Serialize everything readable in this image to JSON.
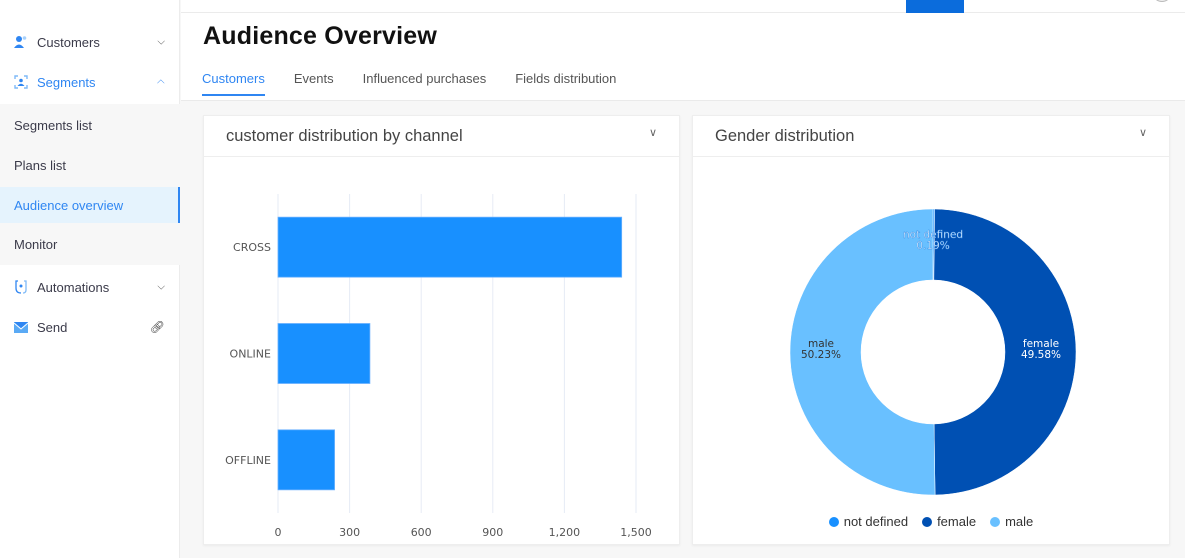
{
  "sidebar": {
    "items": [
      {
        "label": "Customers",
        "icon": "user-group-icon",
        "chevron": "chevron-down"
      },
      {
        "label": "Segments",
        "icon": "segment-icon",
        "chevron": "chevron-up"
      },
      {
        "label": "Automations",
        "icon": "automation-icon",
        "chevron": "chevron-down"
      },
      {
        "label": "Send",
        "icon": "envelope-icon",
        "chevron": "link"
      }
    ],
    "submenu": [
      {
        "label": "Segments list"
      },
      {
        "label": "Plans list"
      },
      {
        "label": "Audience overview"
      },
      {
        "label": "Monitor"
      }
    ]
  },
  "header": {
    "title": "Audience Overview",
    "tabs": [
      {
        "label": "Customers"
      },
      {
        "label": "Events"
      },
      {
        "label": "Influenced purchases"
      },
      {
        "label": "Fields distribution"
      }
    ]
  },
  "colors": {
    "accent": "#2f86f2",
    "bar": "#1890ff",
    "female": "#0050b3",
    "male": "#69c0ff",
    "not_defined": "#1890ff"
  },
  "chart_data": [
    {
      "type": "bar",
      "orientation": "horizontal",
      "title": "customer distribution by channel",
      "categories": [
        "CROSS",
        "ONLINE",
        "OFFLINE"
      ],
      "values": [
        1440,
        385,
        237
      ],
      "xlabel": "",
      "ylabel": "",
      "xlim": [
        0,
        1500
      ],
      "xticks": [
        0,
        300,
        600,
        900,
        1200,
        1500
      ],
      "xtick_labels": [
        "0",
        "300",
        "600",
        "900",
        "1,200",
        "1,500"
      ],
      "grid": true
    },
    {
      "type": "pie",
      "donut": true,
      "title": "Gender distribution",
      "labels": [
        "not defined",
        "female",
        "male"
      ],
      "values": [
        0.19,
        49.58,
        50.23
      ],
      "value_labels": [
        "0.19%",
        "49.58%",
        "50.23%"
      ],
      "legend": [
        "not defined",
        "female",
        "male"
      ],
      "legend_position": "bottom"
    }
  ]
}
